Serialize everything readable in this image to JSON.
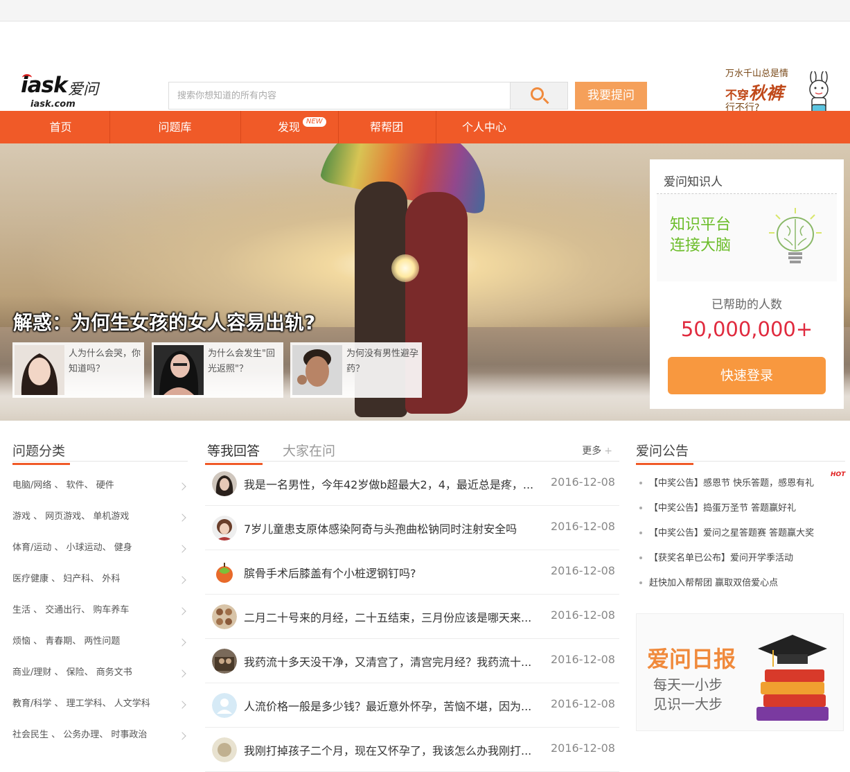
{
  "header": {
    "logo_text": "iask",
    "logo_cn": "爱问",
    "logo_domain": "iask.com",
    "search_placeholder": "搜索你想知道的所有内容",
    "ask_button": "我要提问",
    "promo": {
      "line1": "万水千山总是情",
      "line2a": "不穿",
      "line2b": "秋裤",
      "line3": "行不行?"
    }
  },
  "nav": {
    "items": [
      "首页",
      "问题库",
      "发现",
      "帮帮团",
      "个人中心"
    ],
    "new_badge": "NEW"
  },
  "banner": {
    "title": "解惑：为何生女孩的女人容易出轨?",
    "thumbs": [
      {
        "text": "人为什么会哭，你知道吗？"
      },
      {
        "text": "为什么会发生\"回光返照\"？"
      },
      {
        "text": "为何没有男性避孕药？"
      }
    ]
  },
  "login_panel": {
    "title": "爱问知识人",
    "slogan1": "知识平台",
    "slogan2": "连接大脑",
    "helped_label": "已帮助的人数",
    "helped_count": "50,000,000+",
    "login_button": "快速登录"
  },
  "categories": {
    "title": "问题分类",
    "rows": [
      "电脑/网络 、 软件、 硬件",
      "游戏 、 网页游戏、 单机游戏",
      "体育/运动 、 小球运动、 健身",
      "医疗健康 、 妇产科、 外科",
      "生活 、 交通出行、 购车养车",
      "烦恼 、 青春期、 两性问题",
      "商业/理财 、 保险、 商务文书",
      "教育/科学 、 理工学科、 人文学科",
      "社会民生 、 公务办理、 时事政治"
    ]
  },
  "qa": {
    "tab_active": "等我回答",
    "tab_other": "大家在问",
    "more": "更多",
    "more_plus": "+",
    "questions": [
      {
        "q": "我是一名男性，今年42岁做b超最大2，4，最近总是疼，...",
        "date": "2016-12-08"
      },
      {
        "q": "7岁儿童患支原体感染阿奇与头孢曲松钠同时注射安全吗",
        "date": "2016-12-08"
      },
      {
        "q": "膑骨手术后膝盖有个小桩逻钢钉吗?",
        "date": "2016-12-08"
      },
      {
        "q": "二月二十号来的月经，二十五结束，三月份应该是哪天来...",
        "date": "2016-12-08"
      },
      {
        "q": "我药流十多天没干净，又清宫了，清宫完月经？我药流十...",
        "date": "2016-12-08"
      },
      {
        "q": "人流价格一般是多少钱？最近意外怀孕，苦恼不堪，因为...",
        "date": "2016-12-08"
      },
      {
        "q": "我刚打掉孩子二个月，现在又怀孕了，我该怎么办我刚打...",
        "date": "2016-12-08"
      }
    ]
  },
  "notice": {
    "title": "爱问公告",
    "hot_badge": "HOT",
    "items": [
      "【中奖公告】感恩节 快乐答题，感恩有礼",
      "【中奖公告】捣蛋万圣节 答题赢好礼",
      "【中奖公告】爱问之星答题赛 答题赢大奖",
      "【获奖名单已公布】爱问开学季活动",
      "赶快加入帮帮团 赢取双倍爱心点"
    ]
  },
  "daily": {
    "title": "爱问日报",
    "line1": "每天一小步",
    "line2": "见识一大步"
  },
  "colors": {
    "accent": "#f05a28",
    "button": "#f8983f",
    "green": "#6cbd2a",
    "red": "#e02a3e"
  }
}
